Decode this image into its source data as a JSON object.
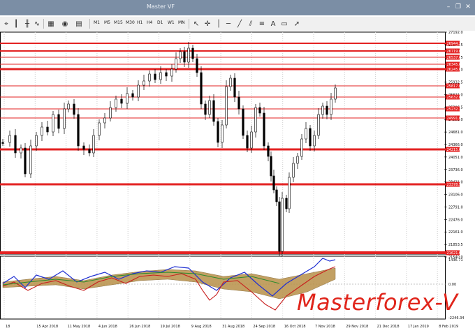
{
  "window": {
    "title": "Master VF"
  },
  "toolbar": {
    "timeframes": [
      "M1",
      "M5",
      "M15",
      "M30",
      "H1",
      "H4",
      "D1",
      "W1",
      "MN"
    ]
  },
  "chart": {
    "price_ticks": [
      "27192.0",
      "26877.5",
      "26562.5",
      "26248.0",
      "25932.5",
      "25621.0",
      "25306.5",
      "24993.0",
      "24681.0",
      "24366.0",
      "24051.0",
      "23736.0",
      "23421.0",
      "23106.0",
      "22791.0",
      "22476.0",
      "22161.0",
      "21853.5",
      "21540.0"
    ],
    "levels": [
      {
        "label": "26944.2",
        "color": "#e32222"
      },
      {
        "label": "26719.6",
        "color": "#e32222"
      },
      {
        "label": "26537.6",
        "color": "#e32222"
      },
      {
        "label": "26345.0",
        "color": "#e32222"
      },
      {
        "label": "26245.0",
        "color": "#e32222"
      },
      {
        "label": "25817.0",
        "color": "#e32222"
      },
      {
        "label": "25632.0",
        "color": "#e32222"
      },
      {
        "label": "25232.3",
        "color": "#e32222"
      },
      {
        "label": "24991.0",
        "color": "#e32222"
      },
      {
        "label": "24215.0",
        "color": "#e32222"
      },
      {
        "label": "23378.5",
        "color": "#e32222"
      },
      {
        "label": "21621.0",
        "color": "#e32222"
      }
    ],
    "dates": [
      "18",
      "15 Apr 2018",
      "11 May 2018",
      "4 Jun 2018",
      "26 Jun 2018",
      "19 Jul 2018",
      "9 Aug 2018",
      "31 Aug 2018",
      "24 Sep 2018",
      "16 Oct 2018",
      "7 Nov 2018",
      "29 Nov 2018",
      "21 Dec 2018",
      "17 Jan 2019",
      "8 Feb 2019"
    ],
    "indicator_ticks": [
      "1436.71",
      "0.00",
      "-2246.34"
    ]
  },
  "brand": {
    "text": "Masterforex-V"
  },
  "colors": {
    "level": "#e32222",
    "candle": "#000000",
    "blue": "#1f2fd2",
    "red": "#c81e1e",
    "green": "#2a8a2a",
    "cloud": "#b89048"
  }
}
